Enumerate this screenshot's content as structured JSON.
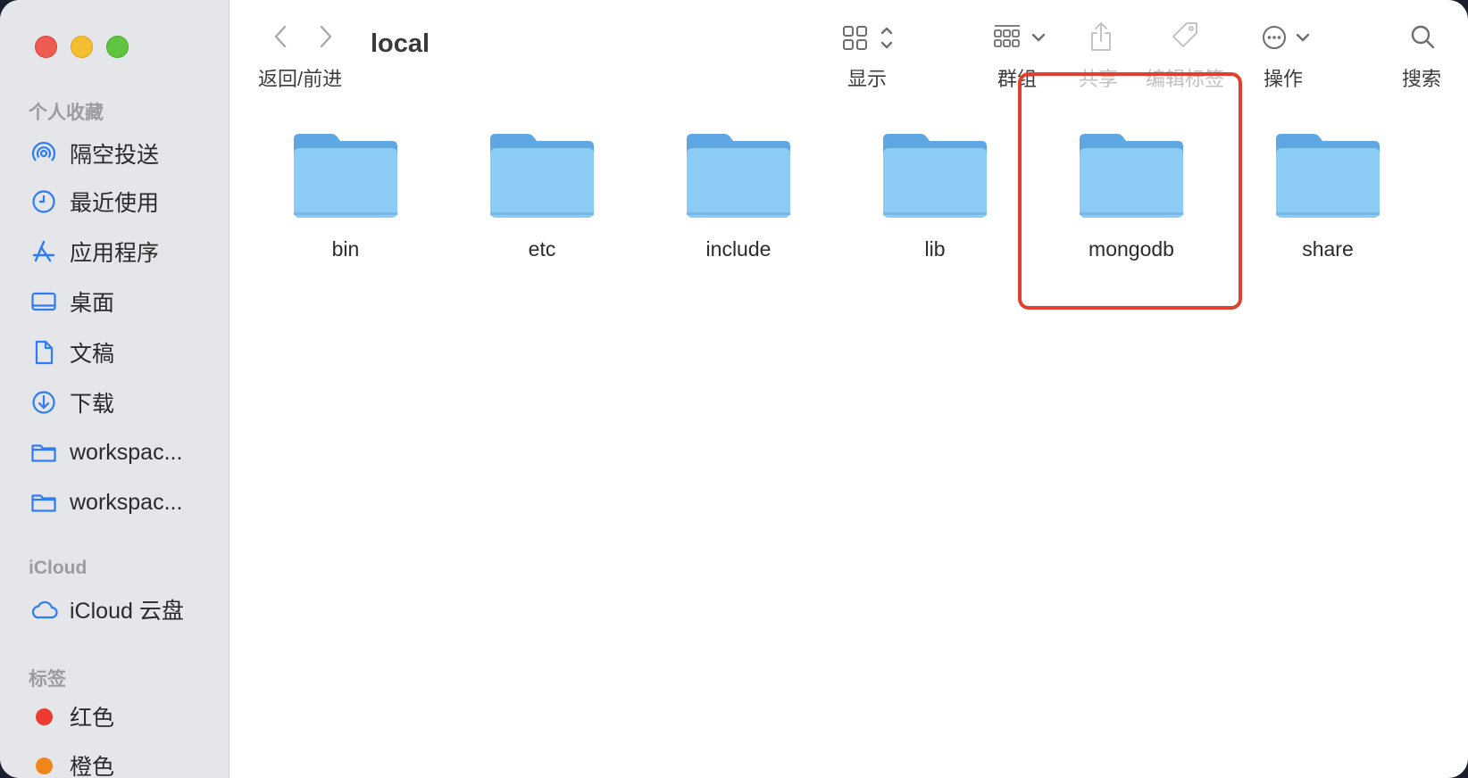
{
  "window": {
    "title": "local"
  },
  "sidebar": {
    "favorites_title": "个人收藏",
    "favorites": [
      {
        "label": "隔空投送",
        "icon": "airdrop-icon"
      },
      {
        "label": "最近使用",
        "icon": "clock-icon"
      },
      {
        "label": "应用程序",
        "icon": "applications-icon"
      },
      {
        "label": "桌面",
        "icon": "desktop-icon"
      },
      {
        "label": "文稿",
        "icon": "document-icon"
      },
      {
        "label": "下载",
        "icon": "download-icon"
      },
      {
        "label": "workspac...",
        "icon": "folder-icon"
      },
      {
        "label": "workspac...",
        "icon": "folder-icon"
      }
    ],
    "icloud_title": "iCloud",
    "icloud": [
      {
        "label": "iCloud 云盘",
        "icon": "cloud-icon"
      }
    ],
    "tags_title": "标签",
    "tags": [
      {
        "label": "红色",
        "color": "#ee3b30"
      },
      {
        "label": "橙色",
        "color": "#f0861a"
      }
    ]
  },
  "toolbar": {
    "nav_label": "返回/前进",
    "view_label": "显示",
    "group_label": "群组",
    "share_label": "共享",
    "tag_label": "编辑标签",
    "action_label": "操作",
    "search_label": "搜索"
  },
  "content": {
    "folders": [
      {
        "name": "bin"
      },
      {
        "name": "etc"
      },
      {
        "name": "include"
      },
      {
        "name": "lib"
      },
      {
        "name": "mongodb",
        "highlighted": true
      },
      {
        "name": "share"
      }
    ],
    "highlight_color": "#e0402d",
    "folder_color": "#8ccbf4"
  }
}
